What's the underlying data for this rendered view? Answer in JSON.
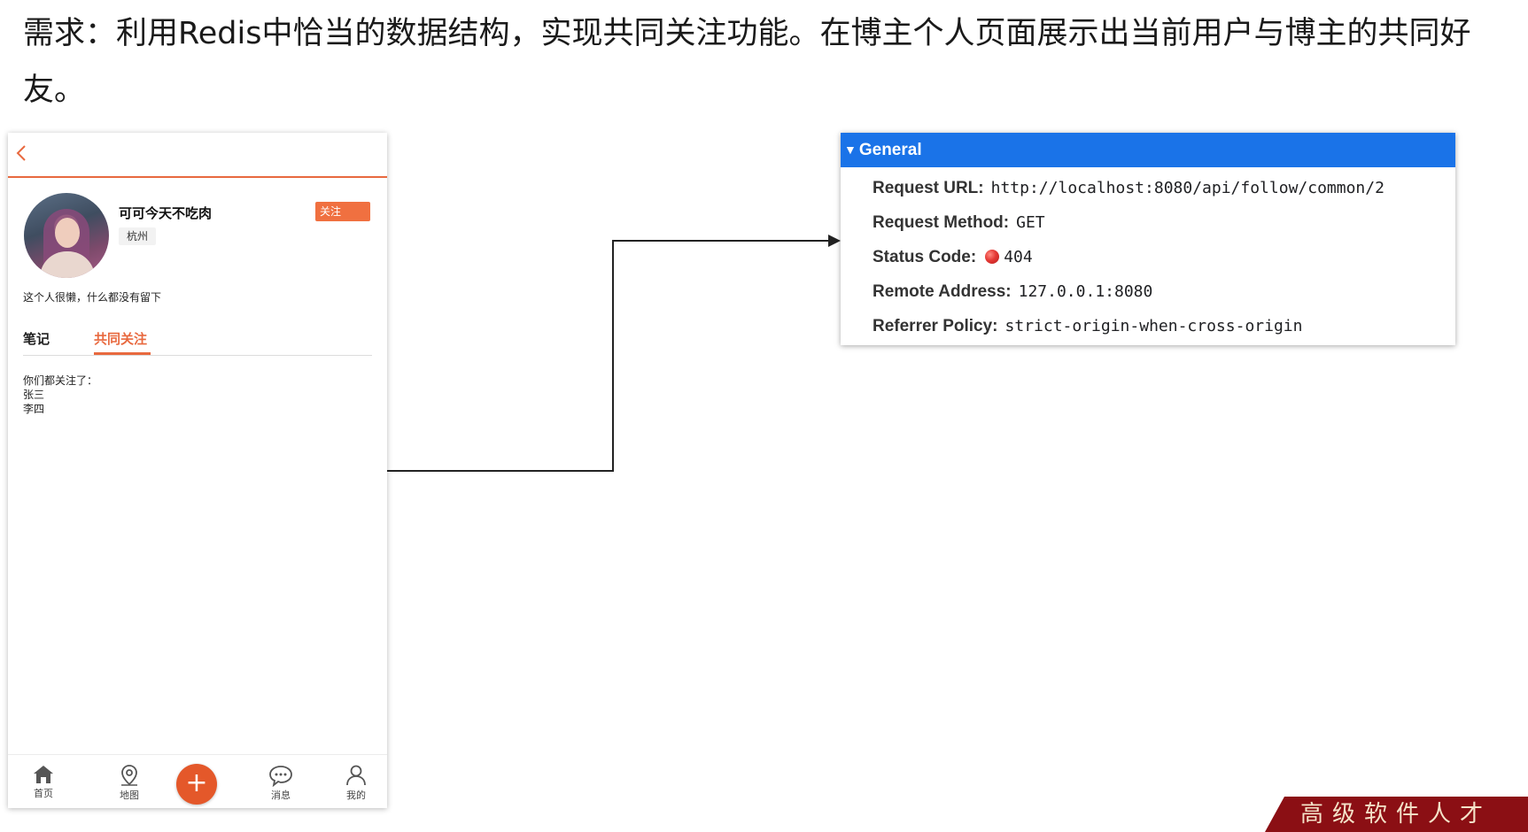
{
  "requirement_text": "需求：利用Redis中恰当的数据结构，实现共同关注功能。在博主个人页面展示出当前用户与博主的共同好友。",
  "phone": {
    "nickname": "可可今天不吃肉",
    "follow_label": "关注",
    "city": "杭州",
    "bio": "这个人很懒，什么都没有留下",
    "tabs": [
      "笔记",
      "共同关注"
    ],
    "active_tab": "共同关注",
    "common_title": "你们都关注了：",
    "common_users": [
      "张三",
      "李四"
    ],
    "tabbar": {
      "home": "首页",
      "map": "地图",
      "plus": "+",
      "message": "消息",
      "mine": "我的"
    },
    "accent_color": "#e8693f"
  },
  "devtools": {
    "section_title": "General",
    "rows": [
      {
        "key": "Request URL:",
        "value": "http://localhost:8080/api/follow/common/2"
      },
      {
        "key": "Request Method:",
        "value": "GET"
      },
      {
        "key": "Status Code:",
        "value": "404"
      },
      {
        "key": "Remote Address:",
        "value": "127.0.0.1:8080"
      },
      {
        "key": "Referrer Policy:",
        "value": "strict-origin-when-cross-origin"
      }
    ],
    "header_color": "#1a73e8",
    "status_color": "#e53935"
  },
  "watermark_text": "高级软件人才"
}
